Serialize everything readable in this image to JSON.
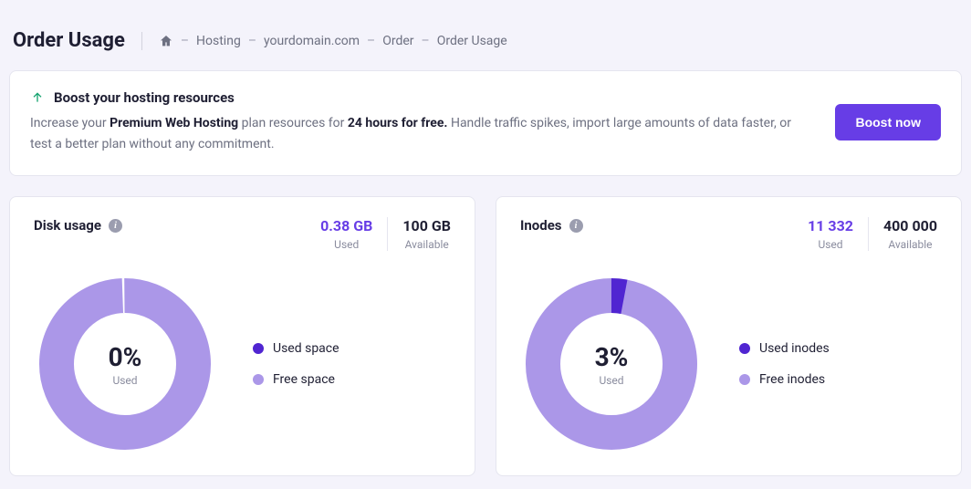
{
  "header": {
    "title": "Order Usage",
    "breadcrumb": {
      "hosting": "Hosting",
      "domain": "yourdomain.com",
      "order": "Order",
      "current": "Order Usage"
    }
  },
  "boost": {
    "title": "Boost your hosting resources",
    "desc_pre": "Increase your ",
    "plan": "Premium Web Hosting",
    "desc_mid": " plan resources for ",
    "duration": "24 hours for free.",
    "desc_post": " Handle traffic spikes, import large amounts of data faster, or test a better plan without any commitment.",
    "button": "Boost now"
  },
  "disk": {
    "title": "Disk usage",
    "used_val": "0.38 GB",
    "used_lbl": "Used",
    "avail_val": "100 GB",
    "avail_lbl": "Available",
    "pct": "0%",
    "pct_lbl": "Used",
    "legend_used": "Used space",
    "legend_free": "Free space"
  },
  "inodes": {
    "title": "Inodes",
    "used_val": "11 332",
    "used_lbl": "Used",
    "avail_val": "400 000",
    "avail_lbl": "Available",
    "pct": "3%",
    "pct_lbl": "Used",
    "legend_used": "Used inodes",
    "legend_free": "Free inodes"
  },
  "chart_data": [
    {
      "type": "pie",
      "title": "Disk usage",
      "series": [
        {
          "name": "Used space",
          "values": [
            0.38
          ]
        },
        {
          "name": "Free space",
          "values": [
            99.62
          ]
        }
      ],
      "unit": "GB",
      "total": 100,
      "percent_used": 0
    },
    {
      "type": "pie",
      "title": "Inodes",
      "series": [
        {
          "name": "Used inodes",
          "values": [
            11332
          ]
        },
        {
          "name": "Free inodes",
          "values": [
            388668
          ]
        }
      ],
      "total": 400000,
      "percent_used": 3
    }
  ]
}
